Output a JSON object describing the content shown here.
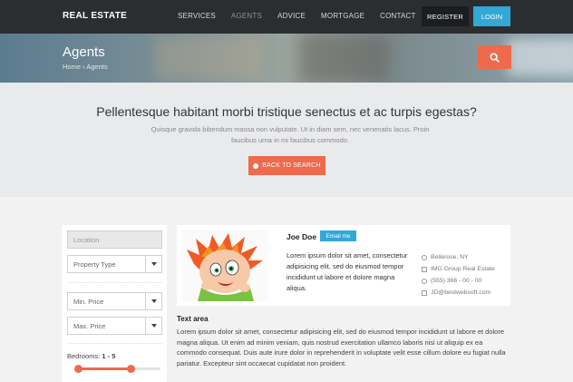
{
  "header": {
    "brand": "REAL ESTATE",
    "nav": [
      "SERVICES",
      "AGENTS",
      "ADVICE",
      "MORTGAGE",
      "CONTACT"
    ],
    "active_nav": "AGENTS",
    "register_label": "REGISTER",
    "login_label": "LOGIN",
    "colors": {
      "bar": "#2b2d31",
      "login": "#31a8d6"
    }
  },
  "hero": {
    "title": "Agents",
    "breadcrumb": "Home › Agents",
    "search_icon": "search-icon",
    "accent": "#ee6a4c"
  },
  "message": {
    "heading": "Pellentesque habitant morbi tristique senectus et ac turpis egestas?",
    "text": "Quisque gravida bibendum massa non vulputate. Ut in diam sem, nec venenatis lacus. Proin faucibus urna in mi faucibus commodo.",
    "back_label": "BACK TO SEARCH"
  },
  "filters": {
    "location_placeholder": "Location",
    "property_type": "Property Type",
    "min_price": "Min. Price",
    "max_price": "Max. Price",
    "bedrooms_label": "Bedrooms:",
    "bedrooms_range": "1 - 5",
    "bedrooms_min": 1,
    "bedrooms_max": 5
  },
  "agent": {
    "name": "Joe Doe",
    "email_label": "Email me",
    "description": "Lorem ipsum dolor sit amet, consectetur adipisicing elit, sed do eiusmod tempor incididunt ut labore et dolore magna aliqua.",
    "location": "Bellerose, NY",
    "company": "IMG Group Real Estate",
    "phone": "(555) 366 - 00 - 00",
    "email": "JD@bestwebsoft.com"
  },
  "text_area": {
    "title": "Text area",
    "body": "Lorem ipsum dolor sit amet, consectetur adipisicing elit, sed do eiusmod tempor incididunt ut labore et dolore magna aliqua. Ut enim ad minim veniam, quis nostrud exercitation ullamco laboris nisi ut aliquip ex ea commodo consequat. Duis aute irure dolor in reprehenderit in voluptate velit esse cillum dolore eu fugiat nulla pariatur. Excepteur sint occaecat cupidatat non proident."
  }
}
